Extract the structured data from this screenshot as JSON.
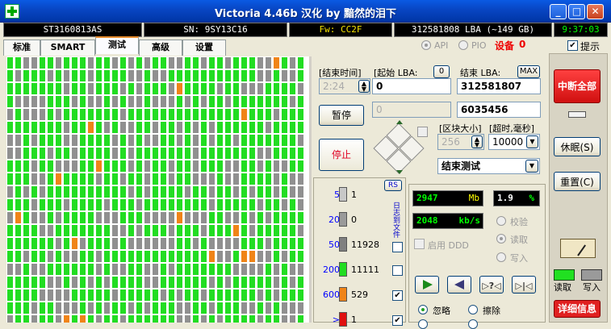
{
  "window": {
    "title": "Victoria 4.46b 汉化 by 黯然的泪下",
    "min": "_",
    "max": "□",
    "close": "✕"
  },
  "infobar": {
    "model": "ST3160813AS",
    "serial": "SN: 9SY13C16",
    "firmware": "Fw: CC2F",
    "capacity": "312581808 LBA (~149 GB)",
    "time": "9:37:03"
  },
  "tabs": [
    "标准",
    "SMART",
    "测试",
    "高级",
    "设置"
  ],
  "mode": {
    "api": "API",
    "pio": "PIO",
    "device_label": "设备",
    "device_num": "0",
    "hint": "提示"
  },
  "test": {
    "end_time_label": "[结束时间]",
    "start_lba_label": "[起始 LBA:",
    "start_lba_btn": "0",
    "end_lba_label": "结束 LBA:",
    "max_btn": "MAX",
    "time_value": "2:24",
    "start_lba_value": "0",
    "end_lba_value": "312581807",
    "pause": "暂停",
    "stop": "停止",
    "progress_value": "0",
    "progress_count": "6035456",
    "block_size_label": "[区块大小]",
    "timeout_label": "[超时,毫秒]",
    "block_size_value": "256",
    "timeout_value": "10000",
    "action_value": "结束测试"
  },
  "right": {
    "break_all": "中断全部",
    "sleep": "休眠(S)",
    "reset": "重置(C)",
    "read": "读取",
    "write": "写入",
    "details": "详细信息"
  },
  "legend": {
    "rs": "RS",
    "rows": [
      {
        "ms": "5",
        "color": "#c8c8c8",
        "count": "1"
      },
      {
        "ms": "20",
        "color": "#9a9a9a",
        "count": "0"
      },
      {
        "ms": "50",
        "color": "#808080",
        "count": "11928"
      },
      {
        "ms": "200",
        "color": "#22dd22",
        "count": "11111"
      },
      {
        "ms": "600",
        "color": "#f08418",
        "count": "529"
      },
      {
        "ms": ">",
        "color": "#e01010",
        "count": "1"
      }
    ],
    "side_label": "日志到文件"
  },
  "stats": {
    "mb": "2947",
    "mb_unit": "Mb",
    "pct": "1.9",
    "pct_unit": "%",
    "speed": "2048",
    "speed_unit": "kb/s",
    "verify": "校验",
    "read": "读取",
    "write": "写入",
    "ddd": "启用 DDD",
    "ignore": "忽略",
    "erase": "擦除"
  },
  "colors": {
    "titlebar": "#0845c2",
    "green": "#22dd22",
    "gray": "#909090",
    "orange": "#f08418",
    "red": "#e02020"
  }
}
